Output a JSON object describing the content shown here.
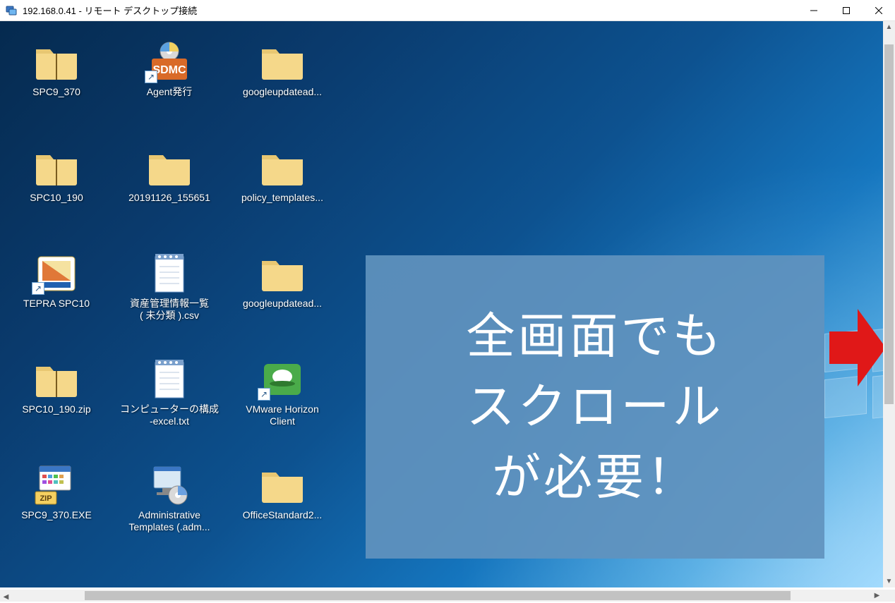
{
  "title": "192.168.0.41 - リモート デスクトップ接続",
  "icons": [
    {
      "type": "folder-zip",
      "label": "SPC9_370"
    },
    {
      "type": "sdmc-shortcut",
      "label": "Agent発行"
    },
    {
      "type": "folder",
      "label": "googleupdatead..."
    },
    {
      "type": "folder-zip",
      "label": "SPC10_190"
    },
    {
      "type": "folder",
      "label": "20191126_155651"
    },
    {
      "type": "folder",
      "label": "policy_templates..."
    },
    {
      "type": "tepra-shortcut",
      "label": "TEPRA SPC10"
    },
    {
      "type": "notepad",
      "label": "資産管理情報一覧\n( 未分類 ).csv"
    },
    {
      "type": "folder",
      "label": "googleupdatead..."
    },
    {
      "type": "folder-zip",
      "label": "SPC10_190.zip"
    },
    {
      "type": "notepad",
      "label": "コンピューターの構成\n-excel.txt"
    },
    {
      "type": "vmware-shortcut",
      "label": "VMware Horizon\nClient"
    },
    {
      "type": "exe-zip",
      "label": "SPC9_370.EXE"
    },
    {
      "type": "admin-templates",
      "label": "Administrative\nTemplates (.adm..."
    },
    {
      "type": "folder",
      "label": "OfficeStandard2..."
    }
  ],
  "callout": "全画面でも\nスクロール\nが必要！"
}
